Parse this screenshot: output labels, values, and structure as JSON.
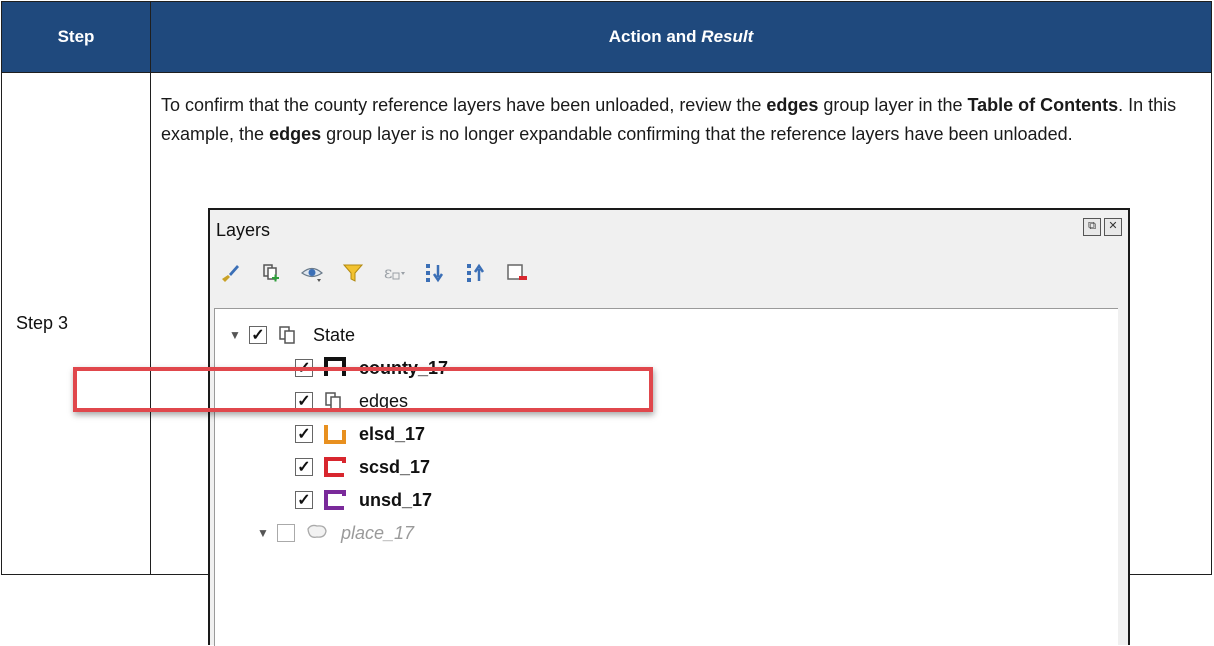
{
  "header": {
    "step": "Step",
    "action_prefix": "Action and ",
    "action_result": "Result"
  },
  "row": {
    "step_label": "Step 3",
    "paragraph": {
      "p1": "To confirm that the county reference layers have been unloaded, review the ",
      "b1": "edges",
      "p2": " group layer in the ",
      "b2": "Table of Contents",
      "p3": ". In this example, the ",
      "b3": "edges",
      "p4": " group layer is no longer expandable confirming that the reference layers have been unloaded."
    }
  },
  "layers_panel": {
    "title": "Layers",
    "toolbar_icons": [
      "style-brush-icon",
      "add-group-icon",
      "visibility-icon",
      "filter-icon",
      "expression-filter-icon",
      "expand-all-icon",
      "collapse-all-icon",
      "remove-layer-icon"
    ],
    "layers": [
      {
        "name": "State",
        "checked": true,
        "kind": "group",
        "expanded": true
      },
      {
        "name": "county_17",
        "checked": true,
        "kind": "polygon",
        "color": "#111111"
      },
      {
        "name": "edges",
        "checked": true,
        "kind": "group"
      },
      {
        "name": "elsd_17",
        "checked": true,
        "kind": "polygon",
        "color": "#e8901f"
      },
      {
        "name": "scsd_17",
        "checked": true,
        "kind": "polygon",
        "color": "#d8262e"
      },
      {
        "name": "unsd_17",
        "checked": true,
        "kind": "polygon",
        "color": "#7a2a9a"
      },
      {
        "name": "place_17",
        "checked": false,
        "kind": "polygon-group",
        "expanded": true
      }
    ]
  },
  "colors": {
    "header_bg": "#1f497d",
    "highlight": "#e0474c"
  }
}
